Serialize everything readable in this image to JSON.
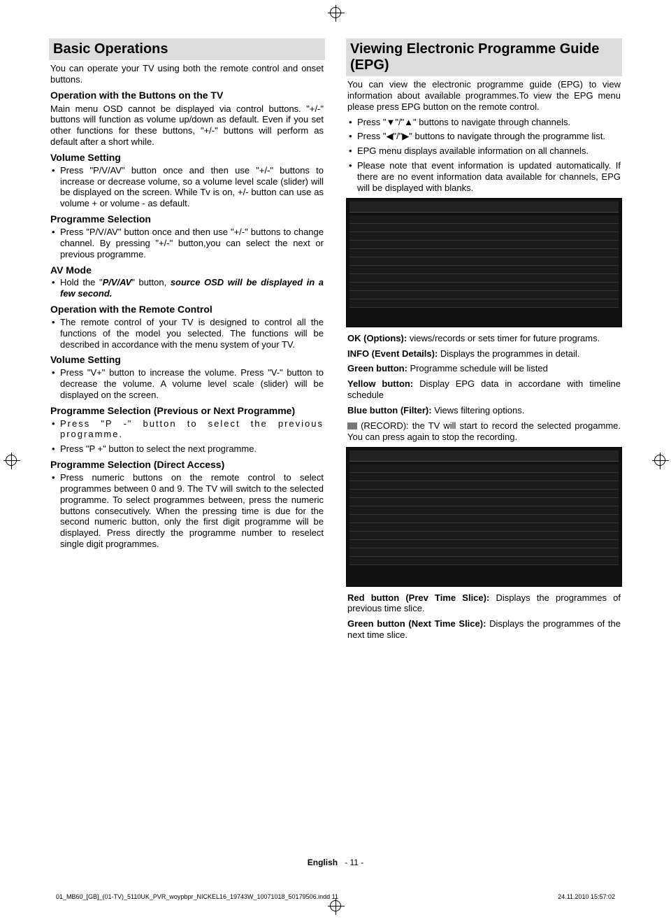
{
  "left": {
    "title": "Basic Operations",
    "intro": "You can operate your TV using both the remote control and onset buttons.",
    "h1": "Operation with the Buttons on the TV",
    "p1": "Main menu OSD cannot be displayed via control buttons. \"+/-\" buttons will function as volume up/down as default. Even if you set other functions for these buttons, \"+/-\" buttons will perform as default after a short while.",
    "h2": "Volume Setting",
    "b2": "Press \"P/V/AV\" button once and then use \"+/-\" buttons to increase or decrease volume, so a volume level scale (slider) will be displayed on the screen. While Tv is on, +/- button can use as volume + or volume - as default.",
    "h3": "Programme Selection",
    "b3": "Press \"P/V/AV\" button once and then use \"+/-\" buttons to change channel. By pressing \"+/-\" button,you can select the next or previous programme.",
    "h4": "AV Mode",
    "b4_pre": "Hold the \"",
    "b4_bi1": "P/V/AV",
    "b4_mid": "\" button, ",
    "b4_bi2": "source OSD will be displayed in a few second.",
    "h5": "Operation with the Remote Control",
    "b5": "The remote control of your TV is designed to control all the functions of the model you selected. The functions will be described in accordance with the menu system of your TV.",
    "h6": "Volume Setting",
    "b6": "Press \"V+\" button to increase the volume. Press \"V-\" button to decrease the volume. A volume level scale (slider) will be displayed on the screen.",
    "h7": "Programme Selection (Previous or Next Programme)",
    "b7a": "Press \"P -\" button to select the previous programme.",
    "b7b": "Press \"P +\" button to select the next programme.",
    "h8": "Programme Selection (Direct Access)",
    "b8": "Press numeric buttons on the remote control to select programmes between 0 and 9. The TV will switch to the selected programme. To select programmes between, press the numeric buttons consecutively. When the pressing time is due for the second numeric button, only the first digit programme will be displayed.  Press directly the programme number to reselect single digit programmes."
  },
  "right": {
    "title": "Viewing Electronic Programme Guide (EPG)",
    "intro": "You can view the electronic programme guide (EPG) to view information about available programmes.To view the EPG menu please press EPG button on the remote control.",
    "b1": "Press \"▼\"/\"▲\" buttons to navigate through channels.",
    "b2": "Press \"◀\"/\"▶\" buttons to navigate through the programme list.",
    "b3": "EPG menu displays available information on all channels.",
    "b4": "Please note that event information is updated automatically. If there are no event information data available for channels, EPG will be displayed with blanks.",
    "ok_b": "OK (Options):",
    "ok_t": " views/records or sets timer for future programs.",
    "info_b": "INFO (Event Details):",
    "info_t": " Displays the programmes in detail.",
    "green_b": "Green button:",
    "green_t": " Programme schedule will be listed",
    "yellow_b": "Yellow button:",
    "yellow_t": " Display EPG data in accordane with timeline schedule",
    "blue_b": "Blue button (Filter):",
    "blue_t": " Views filtering options.",
    "rec_t": " (RECORD): the TV will start to record the selected progamme. You can press again to stop the recording.",
    "red_b": "Red button (Prev Time Slice):",
    "red_t": " Displays the programmes of previous time slice.",
    "green2_b": "Green button (Next Time Slice):",
    "green2_t": " Displays the programmes of the next time slice."
  },
  "footer": {
    "lang": "English",
    "page": "- 11 -"
  },
  "print": {
    "file": "01_MB60_[GB]_(01-TV)_5110UK_PVR_woypbpr_NICKEL16_19743W_10071018_50179506.indd   11",
    "date": "24.11.2010   15:57:02"
  }
}
